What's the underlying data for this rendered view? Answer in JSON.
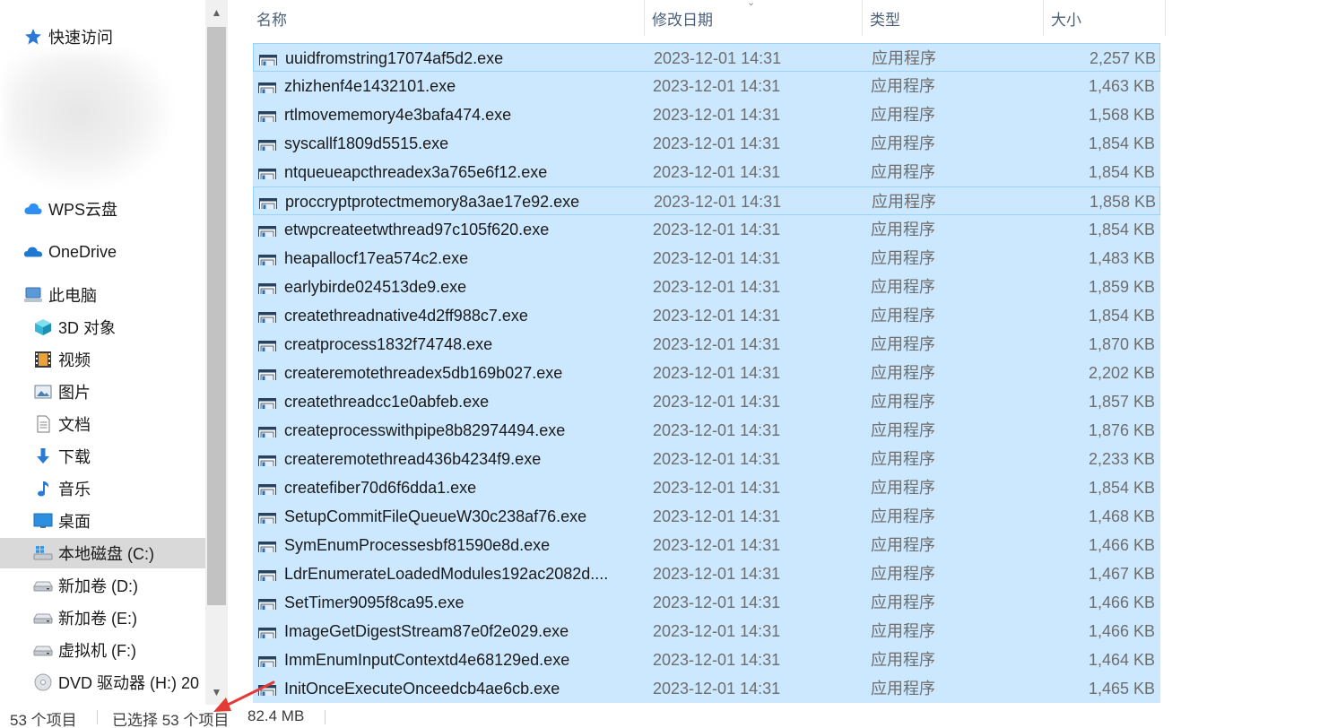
{
  "nav": {
    "items": [
      {
        "label": "快速访问",
        "icon": "star-icon"
      },
      {
        "label": "WPS云盘",
        "icon": "cloud-icon"
      },
      {
        "label": "OneDrive",
        "icon": "onedrive-icon"
      },
      {
        "label": "此电脑",
        "icon": "computer-icon"
      },
      {
        "label": "3D 对象",
        "icon": "cube-icon"
      },
      {
        "label": "视频",
        "icon": "film-icon"
      },
      {
        "label": "图片",
        "icon": "picture-icon"
      },
      {
        "label": "文档",
        "icon": "document-icon"
      },
      {
        "label": "下载",
        "icon": "download-icon"
      },
      {
        "label": "音乐",
        "icon": "music-icon"
      },
      {
        "label": "桌面",
        "icon": "desktop-icon"
      },
      {
        "label": "本地磁盘 (C:)",
        "icon": "windows-drive-icon"
      },
      {
        "label": "新加卷 (D:)",
        "icon": "drive-icon"
      },
      {
        "label": "新加卷 (E:)",
        "icon": "drive-icon"
      },
      {
        "label": "虚拟机 (F:)",
        "icon": "drive-icon"
      },
      {
        "label": "DVD 驱动器 (H:) 20",
        "icon": "dvd-icon"
      }
    ]
  },
  "columns": {
    "name": "名称",
    "date": "修改日期",
    "type": "类型",
    "size": "大小"
  },
  "files": [
    {
      "name": "uuidfromstring17074af5d2.exe",
      "date": "2023-12-01 14:31",
      "type": "应用程序",
      "size": "2,257 KB"
    },
    {
      "name": "zhizhenf4e1432101.exe",
      "date": "2023-12-01 14:31",
      "type": "应用程序",
      "size": "1,463 KB"
    },
    {
      "name": "rtlmovememory4e3bafa474.exe",
      "date": "2023-12-01 14:31",
      "type": "应用程序",
      "size": "1,568 KB"
    },
    {
      "name": "syscallf1809d5515.exe",
      "date": "2023-12-01 14:31",
      "type": "应用程序",
      "size": "1,854 KB"
    },
    {
      "name": "ntqueueapcthreadex3a765e6f12.exe",
      "date": "2023-12-01 14:31",
      "type": "应用程序",
      "size": "1,854 KB"
    },
    {
      "name": "proccryptprotectmemory8a3ae17e92.exe",
      "date": "2023-12-01 14:31",
      "type": "应用程序",
      "size": "1,858 KB"
    },
    {
      "name": "etwpcreateetwthread97c105f620.exe",
      "date": "2023-12-01 14:31",
      "type": "应用程序",
      "size": "1,854 KB"
    },
    {
      "name": "heapallocf17ea574c2.exe",
      "date": "2023-12-01 14:31",
      "type": "应用程序",
      "size": "1,483 KB"
    },
    {
      "name": "earlybirde024513de9.exe",
      "date": "2023-12-01 14:31",
      "type": "应用程序",
      "size": "1,859 KB"
    },
    {
      "name": "createthreadnative4d2ff988c7.exe",
      "date": "2023-12-01 14:31",
      "type": "应用程序",
      "size": "1,854 KB"
    },
    {
      "name": "creatprocess1832f74748.exe",
      "date": "2023-12-01 14:31",
      "type": "应用程序",
      "size": "1,870 KB"
    },
    {
      "name": "createremotethreadex5db169b027.exe",
      "date": "2023-12-01 14:31",
      "type": "应用程序",
      "size": "2,202 KB"
    },
    {
      "name": "createthreadcc1e0abfeb.exe",
      "date": "2023-12-01 14:31",
      "type": "应用程序",
      "size": "1,857 KB"
    },
    {
      "name": "createprocesswithpipe8b82974494.exe",
      "date": "2023-12-01 14:31",
      "type": "应用程序",
      "size": "1,876 KB"
    },
    {
      "name": "createremotethread436b4234f9.exe",
      "date": "2023-12-01 14:31",
      "type": "应用程序",
      "size": "2,233 KB"
    },
    {
      "name": "createfiber70d6f6dda1.exe",
      "date": "2023-12-01 14:31",
      "type": "应用程序",
      "size": "1,854 KB"
    },
    {
      "name": "SetupCommitFileQueueW30c238af76.exe",
      "date": "2023-12-01 14:31",
      "type": "应用程序",
      "size": "1,468 KB"
    },
    {
      "name": "SymEnumProcessesbf81590e8d.exe",
      "date": "2023-12-01 14:31",
      "type": "应用程序",
      "size": "1,466 KB"
    },
    {
      "name": "LdrEnumerateLoadedModules192ac2082d....",
      "date": "2023-12-01 14:31",
      "type": "应用程序",
      "size": "1,467 KB"
    },
    {
      "name": "SetTimer9095f8ca95.exe",
      "date": "2023-12-01 14:31",
      "type": "应用程序",
      "size": "1,466 KB"
    },
    {
      "name": "ImageGetDigestStream87e0f2e029.exe",
      "date": "2023-12-01 14:31",
      "type": "应用程序",
      "size": "1,466 KB"
    },
    {
      "name": "ImmEnumInputContextd4e68129ed.exe",
      "date": "2023-12-01 14:31",
      "type": "应用程序",
      "size": "1,464 KB"
    },
    {
      "name": "InitOnceExecuteOnceedcb4ae6cb.exe",
      "date": "2023-12-01 14:31",
      "type": "应用程序",
      "size": "1,465 KB"
    }
  ],
  "status": {
    "item_count": "53 个项目",
    "selected": "已选择 53 个项目",
    "selected_size": "82.4 MB"
  },
  "colors": {
    "selection": "#cce8ff",
    "focus_border": "#99d1ff",
    "nav_selected": "#d9d9d9",
    "annotation_arrow": "#e53935"
  }
}
